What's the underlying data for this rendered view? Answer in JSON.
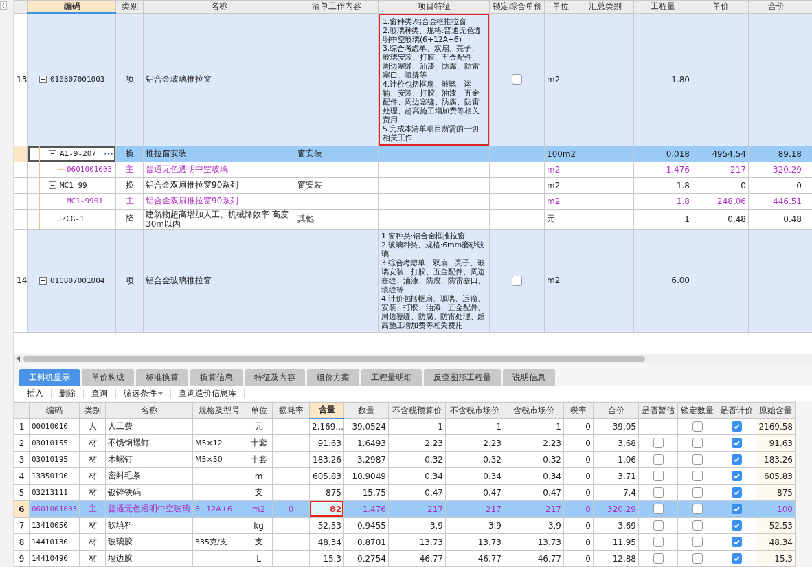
{
  "top_table": {
    "columns": [
      {
        "label": "编码",
        "selected": true
      },
      {
        "label": "类别",
        "selected": false
      },
      {
        "label": "名称",
        "selected": false
      },
      {
        "label": "清单工作内容",
        "selected": false
      },
      {
        "label": "项目特征",
        "selected": false
      },
      {
        "label": "锁定综合单价",
        "selected": false
      },
      {
        "label": "单位",
        "selected": false
      },
      {
        "label": "汇总类别",
        "selected": false
      },
      {
        "label": "工程量",
        "selected": false
      },
      {
        "label": "单价",
        "selected": false
      },
      {
        "label": "合价",
        "selected": false
      }
    ],
    "rows": [
      {
        "number": "13",
        "code": "010807001003",
        "type": "项",
        "kind": "item",
        "name": "铝合金玻璃推拉窗",
        "features": [
          "1.窗种类:铝合金框推拉窗",
          "2.玻璃种类、规格:普通无色透明中空玻璃(6+12A+6)",
          "3.综合考虑单、双扇、亮子、玻璃安装、打胶、五金配件、周边塞缝、油漆、防腐、防雷塞口、填缝等",
          "4.计价包括框扇、玻璃、运输、安装、打胶、油漆、五金配件、周边塞缝、防腐、防雷处理、超高施工增加费等相关费用",
          "5.完成本清单项目所需的一切相关工作"
        ],
        "annotated": true,
        "locked": false,
        "unit": "m2",
        "quantity": "1.80",
        "expanded": true,
        "selected": false,
        "children": [
          {
            "code": "A1-9-207",
            "type": "换",
            "kind": "norm",
            "name": "推拉窗安装",
            "work": "窗安装",
            "unit": "100m2",
            "quantity": "0.018",
            "price": "4954.54",
            "total": "89.18",
            "expanded": true,
            "selected": true,
            "children": [
              {
                "code": "0601001003",
                "type": "主",
                "kind": "material",
                "name": "普通无色透明中空玻璃",
                "unit": "m2",
                "quantity": "1.476",
                "price": "217",
                "total": "320.29",
                "selected": false
              }
            ]
          },
          {
            "code": "MC1-99",
            "type": "换",
            "kind": "norm",
            "name": "铝合金双扇推拉窗90系列",
            "work": "窗安装",
            "unit": "m2",
            "quantity": "1.8",
            "price": "0",
            "total": "0",
            "expanded": true,
            "selected": false,
            "children": [
              {
                "code": "MC1-9901",
                "type": "主",
                "kind": "material",
                "name": "铝合金双扇推拉窗90系列",
                "unit": "m2",
                "quantity": "1.8",
                "price": "248.06",
                "total": "446.51",
                "selected": false
              }
            ]
          },
          {
            "code": "JZCG-1",
            "type": "降",
            "kind": "norm",
            "name": "建筑物超高增加人工、机械降效率 高度30m以内",
            "work": "其他",
            "unit": "元",
            "quantity": "1",
            "price": "0.48",
            "total": "0.48",
            "selected": false
          }
        ]
      },
      {
        "number": "14",
        "code": "010807001004",
        "type": "项",
        "kind": "item",
        "name": "铝合金玻璃推拉窗",
        "features": [
          "1.窗种类:铝合金框推拉窗",
          "2.玻璃种类、规格:6mm磨砂玻璃",
          "3.综合考虑单、双扇、亮子、玻璃安装、打胶、五金配件、周边塞缝、油漆、防腐、防雷塞口、填缝等",
          "4.计价包括框扇、玻璃、运输、安装、打胶、油漆、五金配件、周边塞缝、防腐、防雷处理、超高施工增加费等相关费用"
        ],
        "annotated": false,
        "locked": false,
        "unit": "m2",
        "quantity": "6.00",
        "expanded": true,
        "selected": false
      }
    ]
  },
  "tabs": [
    {
      "label": "工料机显示",
      "selected": true
    },
    {
      "label": "单价构成",
      "selected": false
    },
    {
      "label": "标准换算",
      "selected": false
    },
    {
      "label": "换算信息",
      "selected": false
    },
    {
      "label": "特征及内容",
      "selected": false
    },
    {
      "label": "组价方案",
      "selected": false
    },
    {
      "label": "工程量明细",
      "selected": false
    },
    {
      "label": "反查图形工程量",
      "selected": false
    },
    {
      "label": "说明信息",
      "selected": false
    }
  ],
  "toolbar": [
    {
      "label": "插入",
      "dropdown": false
    },
    {
      "label": "删除",
      "dropdown": false
    },
    {
      "label": "查询",
      "dropdown": false
    },
    {
      "label": "筛选条件",
      "dropdown": true
    },
    {
      "label": "查询造价信息库",
      "dropdown": false
    }
  ],
  "resource_table": {
    "columns": [
      {
        "label": "编码",
        "selected": false
      },
      {
        "label": "类别",
        "selected": false
      },
      {
        "label": "名称",
        "selected": false
      },
      {
        "label": "规格及型号",
        "selected": false
      },
      {
        "label": "单位",
        "selected": false
      },
      {
        "label": "损耗率",
        "selected": false
      },
      {
        "label": "含量",
        "selected": true
      },
      {
        "label": "数量",
        "selected": false
      },
      {
        "label": "不含税预算价",
        "selected": false
      },
      {
        "label": "不含税市场价",
        "selected": false
      },
      {
        "label": "含税市场价",
        "selected": false
      },
      {
        "label": "税率",
        "selected": false
      },
      {
        "label": "合价",
        "selected": false
      },
      {
        "label": "是否暂估",
        "selected": false
      },
      {
        "label": "锁定数量",
        "selected": false
      },
      {
        "label": "是否计价",
        "selected": false
      },
      {
        "label": "原始含量",
        "selected": false
      }
    ],
    "rows": [
      {
        "number": "1",
        "code": "00010010",
        "type": "人",
        "kind": "labor",
        "name": "人工费",
        "unit": "元",
        "content": "2,169…",
        "amount": "39.0524",
        "budget_price": "1",
        "market_price": "1",
        "market_price_tax": "1",
        "tax_rate": "0",
        "total": "39.05",
        "locked": false,
        "priced": true,
        "original": "2169.58",
        "selected": false,
        "annotated": false
      },
      {
        "number": "2",
        "code": "03010155",
        "type": "材",
        "kind": "material",
        "name": "不锈钢螺钉",
        "spec": "M5×12",
        "unit": "十套",
        "content": "91.63",
        "amount": "1.6493",
        "budget_price": "2.23",
        "market_price": "2.23",
        "market_price_tax": "2.23",
        "tax_rate": "0",
        "total": "3.68",
        "estimated": false,
        "locked": false,
        "priced": true,
        "original": "91.63",
        "selected": false,
        "annotated": false
      },
      {
        "number": "3",
        "code": "03010195",
        "type": "材",
        "kind": "material",
        "name": "木螺钉",
        "spec": "M5×50",
        "unit": "十套",
        "content": "183.26",
        "amount": "3.2987",
        "budget_price": "0.32",
        "market_price": "0.32",
        "market_price_tax": "0.32",
        "tax_rate": "0",
        "total": "1.06",
        "estimated": false,
        "locked": false,
        "priced": true,
        "original": "183.26",
        "selected": false,
        "annotated": false
      },
      {
        "number": "4",
        "code": "13350190",
        "type": "材",
        "kind": "material",
        "name": "密封毛条",
        "unit": "m",
        "content": "605.83",
        "amount": "10.9049",
        "budget_price": "0.34",
        "market_price": "0.34",
        "market_price_tax": "0.34",
        "tax_rate": "0",
        "total": "3.71",
        "estimated": false,
        "locked": false,
        "priced": true,
        "original": "605.83",
        "selected": false,
        "annotated": false
      },
      {
        "number": "5",
        "code": "03213111",
        "type": "材",
        "kind": "material",
        "name": "镀锌铁码",
        "unit": "支",
        "content": "875",
        "amount": "15.75",
        "budget_price": "0.47",
        "market_price": "0.47",
        "market_price_tax": "0.47",
        "tax_rate": "0",
        "total": "7.4",
        "estimated": false,
        "locked": false,
        "priced": true,
        "original": "875",
        "selected": false,
        "annotated": false
      },
      {
        "number": "6",
        "code": "0601001003",
        "type": "主",
        "kind": "main",
        "name": "普通无色透明中空玻璃",
        "spec": "6+12A+6",
        "unit": "m2",
        "loss": "0",
        "content": "82",
        "amount": "1.476",
        "budget_price": "217",
        "market_price": "217",
        "market_price_tax": "217",
        "tax_rate": "0",
        "total": "320.29",
        "estimated": false,
        "locked": false,
        "priced": true,
        "original": "100",
        "selected": true,
        "annotated": true
      },
      {
        "number": "7",
        "code": "13410050",
        "type": "材",
        "kind": "material",
        "name": "软填料",
        "unit": "kg",
        "content": "52.53",
        "amount": "0.9455",
        "budget_price": "3.9",
        "market_price": "3.9",
        "market_price_tax": "3.9",
        "tax_rate": "0",
        "total": "3.69",
        "estimated": false,
        "locked": false,
        "priced": true,
        "original": "52.53",
        "selected": false,
        "annotated": false
      },
      {
        "number": "8",
        "code": "14410130",
        "type": "材",
        "kind": "material",
        "name": "玻璃胶",
        "spec": "335克/支",
        "unit": "支",
        "content": "48.34",
        "amount": "0.8701",
        "budget_price": "13.73",
        "market_price": "13.73",
        "market_price_tax": "13.73",
        "tax_rate": "0",
        "total": "11.95",
        "estimated": false,
        "locked": false,
        "priced": true,
        "original": "48.34",
        "selected": false,
        "annotated": false
      },
      {
        "number": "9",
        "code": "14410490",
        "type": "材",
        "kind": "material",
        "name": "墙边胶",
        "unit": "L",
        "content": "15.3",
        "amount": "0.2754",
        "budget_price": "46.77",
        "market_price": "46.77",
        "market_price_tax": "46.77",
        "tax_rate": "0",
        "total": "12.88",
        "estimated": false,
        "locked": false,
        "priced": true,
        "original": "15.3",
        "selected": false,
        "annotated": false
      }
    ]
  }
}
